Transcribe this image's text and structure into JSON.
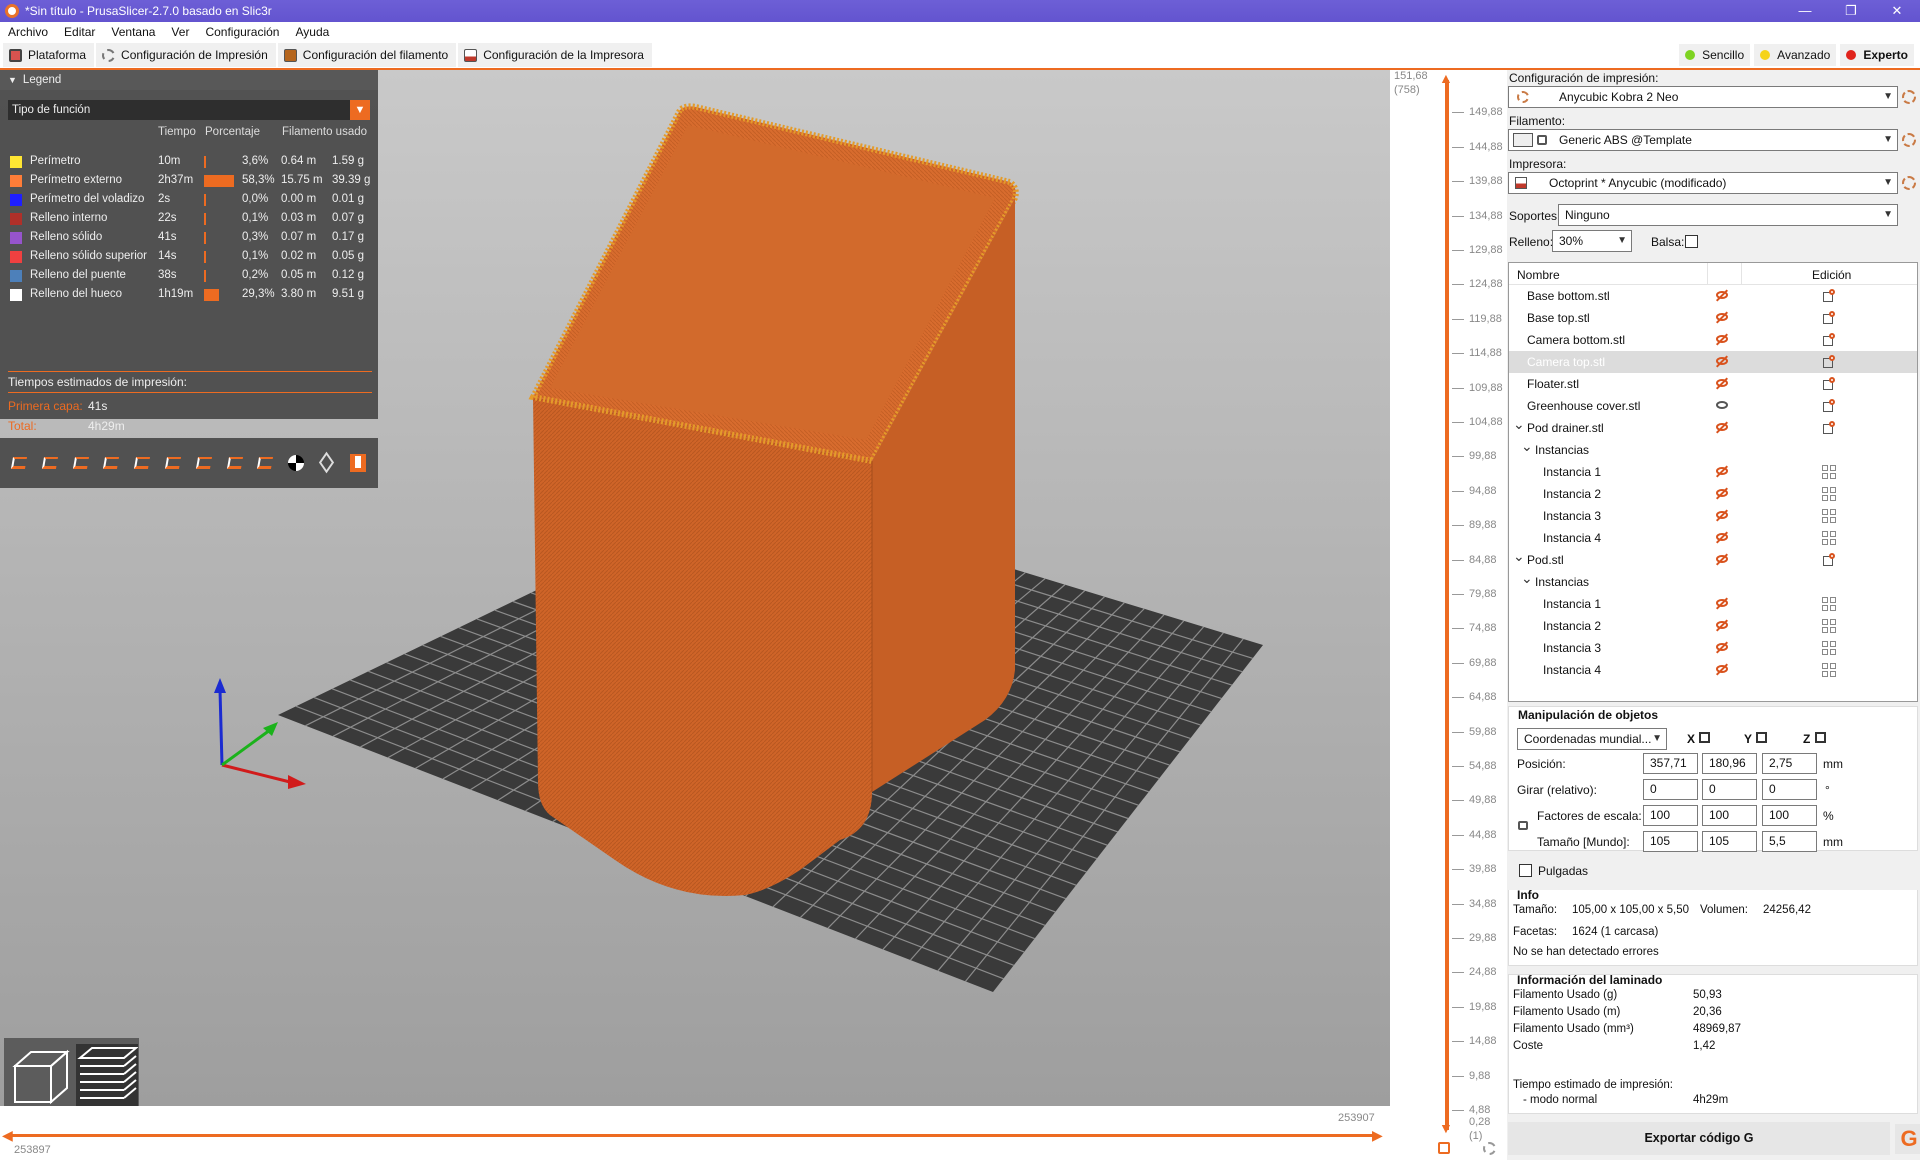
{
  "window": {
    "title": "*Sin título - PrusaSlicer-2.7.0 basado en Slic3r",
    "controls": [
      "—",
      "❐",
      "✕"
    ]
  },
  "menu": [
    "Archivo",
    "Editar",
    "Ventana",
    "Ver",
    "Configuración",
    "Ayuda"
  ],
  "tabs": [
    {
      "label": "Plataforma",
      "color": "#d9534f"
    },
    {
      "label": "Configuración de Impresión",
      "color": "#8a8a8a"
    },
    {
      "label": "Configuración del filamento",
      "color": "#b5651d"
    },
    {
      "label": "Configuración de la Impresora",
      "color": "#c0392b"
    }
  ],
  "modes": [
    {
      "label": "Sencillo",
      "color": "#7ed321",
      "active": false
    },
    {
      "label": "Avanzado",
      "color": "#f5d31a",
      "active": false
    },
    {
      "label": "Experto",
      "color": "#e0231b",
      "active": true
    }
  ],
  "legend": {
    "header": "Legend",
    "type_select": "Tipo de función",
    "columns": {
      "time": "Tiempo",
      "percent": "Porcentaje",
      "filament": "Filamento usado"
    },
    "rows": [
      {
        "name": "Perímetro",
        "color": "#ffe633",
        "time": "10m",
        "percent": "3,6%",
        "pct": 3.6,
        "m": "0.64 m",
        "g": "1.59 g"
      },
      {
        "name": "Perímetro externo",
        "color": "#ff7d38",
        "time": "2h37m",
        "percent": "58,3%",
        "pct": 58.3,
        "m": "15.75 m",
        "g": "39.39 g"
      },
      {
        "name": "Perímetro del voladizo",
        "color": "#1f1fff",
        "time": "2s",
        "percent": "0,0%",
        "pct": 0.0,
        "m": "0.00 m",
        "g": "0.01 g"
      },
      {
        "name": "Relleno interno",
        "color": "#b03029",
        "time": "22s",
        "percent": "0,1%",
        "pct": 0.1,
        "m": "0.03 m",
        "g": "0.07 g"
      },
      {
        "name": "Relleno sólido",
        "color": "#9654cc",
        "time": "41s",
        "percent": "0,3%",
        "pct": 0.3,
        "m": "0.07 m",
        "g": "0.17 g"
      },
      {
        "name": "Relleno sólido superior",
        "color": "#f04040",
        "time": "14s",
        "percent": "0,1%",
        "pct": 0.1,
        "m": "0.02 m",
        "g": "0.05 g"
      },
      {
        "name": "Relleno del puente",
        "color": "#4d80ba",
        "time": "38s",
        "percent": "0,2%",
        "pct": 0.2,
        "m": "0.05 m",
        "g": "0.12 g"
      },
      {
        "name": "Relleno del hueco",
        "color": "#ffffff",
        "time": "1h19m",
        "percent": "29,3%",
        "pct": 29.3,
        "m": "3.80 m",
        "g": "9.51 g"
      }
    ],
    "estimated_title": "Tiempos estimados de impresión:",
    "first_layer_label": "Primera capa:",
    "first_layer_value": "41s",
    "total_label": "Total:",
    "total_value": "4h29m"
  },
  "horizontal_slider": {
    "right_value": "253907",
    "left_value": "253897"
  },
  "vertical_slider": {
    "top_value": "151,68",
    "top_layer": "(758)",
    "bottom_value": "0,28",
    "bottom_layer": "(1)",
    "ticks": [
      "149,88",
      "144,88",
      "139,88",
      "134,88",
      "129,88",
      "124,88",
      "119,88",
      "114,88",
      "109,88",
      "104,88",
      "99,88",
      "94,88",
      "89,88",
      "84,88",
      "79,88",
      "74,88",
      "69,88",
      "64,88",
      "59,88",
      "54,88",
      "49,88",
      "44,88",
      "39,88",
      "34,88",
      "29,88",
      "24,88",
      "19,88",
      "14,88",
      "9,88",
      "4,88"
    ]
  },
  "sidebar": {
    "print_label": "Configuración de impresión:",
    "print_value": "Anycubic Kobra 2 Neo",
    "filament_label": "Filamento:",
    "filament_value": "Generic ABS @Template",
    "printer_label": "Impresora:",
    "printer_value": "Octoprint * Anycubic (modificado)",
    "supports_label": "Soportes:",
    "supports_value": "Ninguno",
    "infill_label": "Relleno:",
    "infill_value": "30%",
    "raft_label": "Balsa:"
  },
  "objects": {
    "col_name": "Nombre",
    "col_edit": "Edición",
    "rows": [
      {
        "name": "Base bottom.stl",
        "level": 0,
        "eye": "hidden",
        "edit": "edit",
        "selected": false,
        "arrow": ""
      },
      {
        "name": "Base top.stl",
        "level": 0,
        "eye": "hidden",
        "edit": "edit",
        "selected": false,
        "arrow": ""
      },
      {
        "name": "Camera bottom.stl",
        "level": 0,
        "eye": "hidden",
        "edit": "edit",
        "selected": false,
        "arrow": ""
      },
      {
        "name": "Camera top.stl",
        "level": 0,
        "eye": "hidden",
        "edit": "edit",
        "selected": true,
        "arrow": ""
      },
      {
        "name": "Floater.stl",
        "level": 0,
        "eye": "hidden",
        "edit": "edit",
        "selected": false,
        "arrow": ""
      },
      {
        "name": "Greenhouse cover.stl",
        "level": 0,
        "eye": "visible",
        "edit": "edit",
        "selected": false,
        "arrow": ""
      },
      {
        "name": "Pod drainer.stl",
        "level": -1,
        "eye": "hidden",
        "edit": "edit",
        "selected": false,
        "arrow": "v"
      },
      {
        "name": "Instancias",
        "level": 1,
        "eye": "",
        "edit": "",
        "selected": false,
        "arrow": "v"
      },
      {
        "name": "Instancia 1",
        "level": 2,
        "eye": "hidden",
        "edit": "grid",
        "selected": false,
        "arrow": ""
      },
      {
        "name": "Instancia 2",
        "level": 2,
        "eye": "hidden",
        "edit": "grid",
        "selected": false,
        "arrow": ""
      },
      {
        "name": "Instancia 3",
        "level": 2,
        "eye": "hidden",
        "edit": "grid",
        "selected": false,
        "arrow": ""
      },
      {
        "name": "Instancia 4",
        "level": 2,
        "eye": "hidden",
        "edit": "grid",
        "selected": false,
        "arrow": ""
      },
      {
        "name": "Pod.stl",
        "level": -1,
        "eye": "hidden",
        "edit": "edit",
        "selected": false,
        "arrow": "v"
      },
      {
        "name": "Instancias",
        "level": 1,
        "eye": "",
        "edit": "",
        "selected": false,
        "arrow": "v"
      },
      {
        "name": "Instancia 1",
        "level": 2,
        "eye": "hidden",
        "edit": "grid",
        "selected": false,
        "arrow": ""
      },
      {
        "name": "Instancia 2",
        "level": 2,
        "eye": "hidden",
        "edit": "grid",
        "selected": false,
        "arrow": ""
      },
      {
        "name": "Instancia 3",
        "level": 2,
        "eye": "hidden",
        "edit": "grid",
        "selected": false,
        "arrow": ""
      },
      {
        "name": "Instancia 4",
        "level": 2,
        "eye": "hidden",
        "edit": "grid",
        "selected": false,
        "arrow": ""
      }
    ]
  },
  "manipulation": {
    "title": "Manipulación de objetos",
    "coords": "Coordenadas mundial...",
    "x": "X",
    "y": "Y",
    "z": "Z",
    "position_label": "Posición:",
    "position": [
      "357,71",
      "180,96",
      "2,75"
    ],
    "position_unit": "mm",
    "rotate_label": "Girar (relativo):",
    "rotate": [
      "0",
      "0",
      "0"
    ],
    "rotate_unit": "°",
    "scale_label": "Factores de escala:",
    "scale": [
      "100",
      "100",
      "100"
    ],
    "scale_unit": "%",
    "size_label": "Tamaño [Mundo]:",
    "size": [
      "105",
      "105",
      "5,5"
    ],
    "size_unit": "mm",
    "inches_label": "Pulgadas"
  },
  "info": {
    "title": "Info",
    "size_label": "Tamaño:",
    "size_value": "105,00 x 105,00 x 5,50",
    "volume_label": "Volumen:",
    "volume_value": "24256,42",
    "facets_label": "Facetas:",
    "facets_value": "1624 (1 carcasa)",
    "errors": "No se han detectado errores"
  },
  "slice_info": {
    "title": "Información del laminado",
    "rows": [
      {
        "label": "Filamento Usado (g)",
        "value": "50,93"
      },
      {
        "label": "Filamento Usado (m)",
        "value": "20,36"
      },
      {
        "label": "Filamento Usado (mm³)",
        "value": "48969,87"
      },
      {
        "label": "Coste",
        "value": "1,42"
      }
    ],
    "time_label": "Tiempo estimado de impresión:",
    "time_mode_label": "- modo normal",
    "time_value": "4h29m"
  },
  "export_label": "Exportar código G",
  "gcode_icon": "G"
}
